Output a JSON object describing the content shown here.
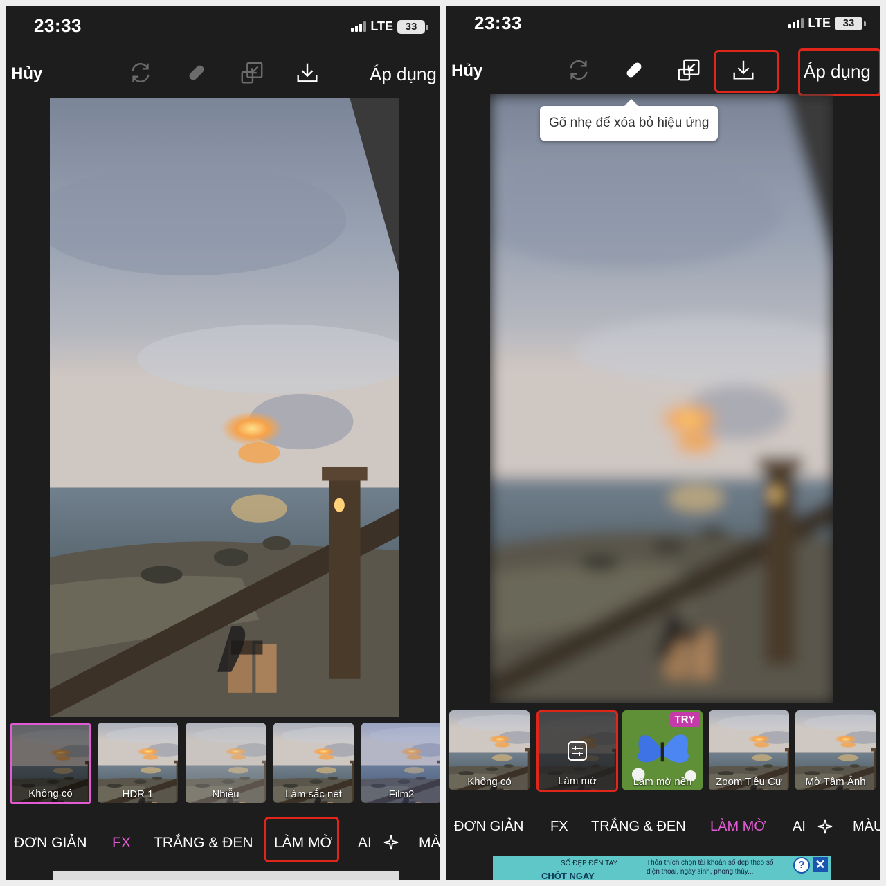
{
  "left": {
    "status": {
      "time": "23:33",
      "network": "LTE",
      "battery": "33"
    },
    "toolbar": {
      "cancel_label": "Hủy",
      "apply_label": "Áp dụng",
      "icons": [
        "refresh-icon",
        "eraser-icon",
        "resize-icon",
        "download-icon"
      ]
    },
    "thumbnails": [
      {
        "label": "Không có",
        "selected": true
      },
      {
        "label": "HDR 1",
        "selected": false
      },
      {
        "label": "Nhiễu",
        "selected": false
      },
      {
        "label": "Làm sắc nét",
        "selected": false
      },
      {
        "label": "Film2",
        "selected": false
      }
    ],
    "tabs": [
      {
        "label": "ĐƠN GIẢN",
        "active": false
      },
      {
        "label": "FX",
        "active": true
      },
      {
        "label": "TRẮNG & ĐEN",
        "active": false
      },
      {
        "label": "LÀM MỜ",
        "active": false
      },
      {
        "label": "AI",
        "active": false
      },
      {
        "label": "MÀ",
        "active": false
      }
    ]
  },
  "right": {
    "status": {
      "time": "23:33",
      "network": "LTE",
      "battery": "33"
    },
    "toolbar": {
      "cancel_label": "Hủy",
      "apply_label": "Áp dụng",
      "icons": [
        "refresh-icon",
        "eraser-icon",
        "resize-icon",
        "download-icon"
      ]
    },
    "tooltip": "Gõ nhẹ để xóa bỏ hiệu ứng",
    "thumbnails": [
      {
        "label": "Không có",
        "selected": false
      },
      {
        "label": "Làm mờ",
        "selected": true
      },
      {
        "label": "Làm mờ nền",
        "badge": "TRY",
        "selected": false
      },
      {
        "label": "Zoom Tiêu Cự",
        "selected": false
      },
      {
        "label": "Mờ Tâm Ảnh",
        "selected": false
      }
    ],
    "tabs": [
      {
        "label": "ĐƠN GIẢN",
        "active": false
      },
      {
        "label": "FX",
        "active": false
      },
      {
        "label": "TRẮNG & ĐEN",
        "active": false
      },
      {
        "label": "LÀM MỜ",
        "active": true
      },
      {
        "label": "AI",
        "active": false
      },
      {
        "label": "MÀU",
        "active": false
      }
    ],
    "ad": {
      "badge": "SỐ ĐẸP ĐẾN TAY",
      "text": "Thỏa thích chọn tài khoản số đẹp theo số điện thoại, ngày sinh, phong thủy...",
      "cta": "CHỐT NGAY"
    }
  },
  "colors": {
    "accent_pink": "#e25bd4",
    "highlight_red": "#e0261a",
    "background": "#1d1d1d"
  }
}
